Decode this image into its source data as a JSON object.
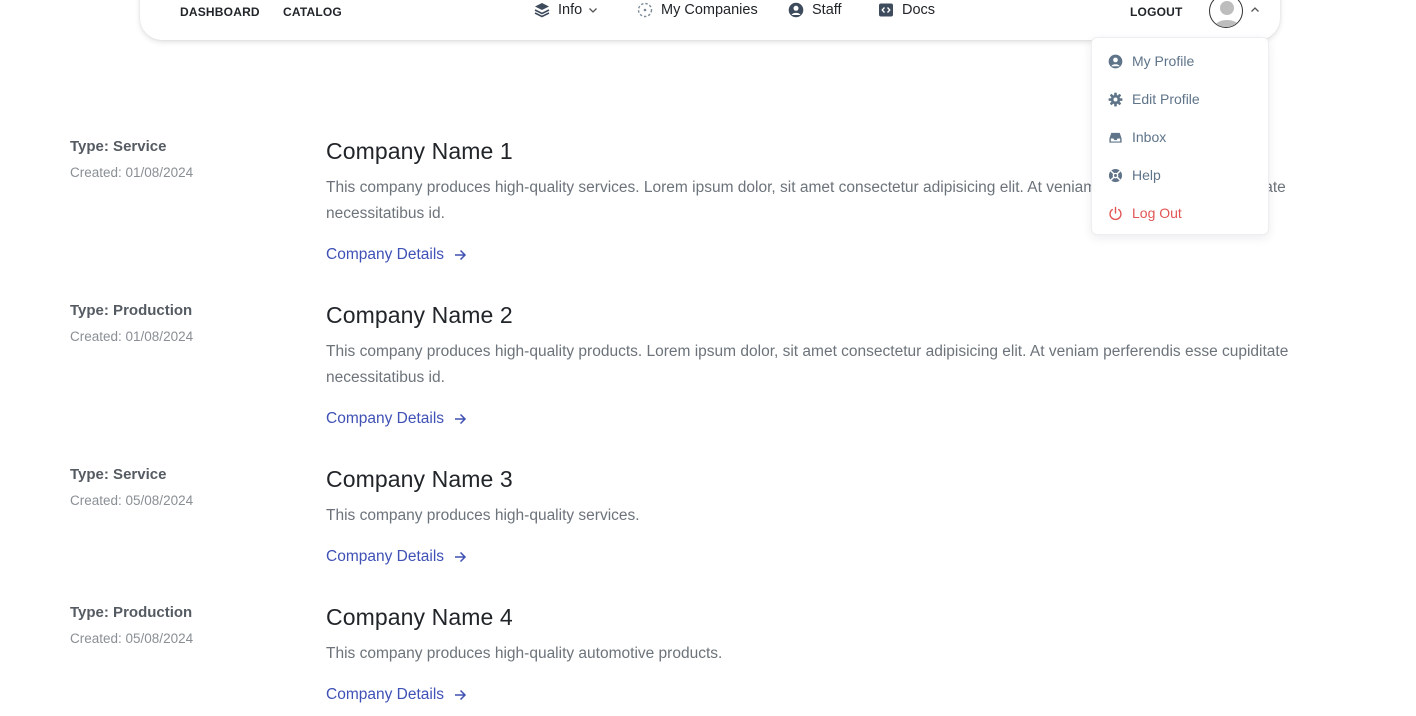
{
  "navbar": {
    "dashboard": "DASHBOARD",
    "catalog": "CATALOG",
    "info": "Info",
    "my_companies": "My Companies",
    "staff": "Staff",
    "docs": "Docs",
    "logout": "LOGOUT"
  },
  "profile_menu": {
    "items": [
      {
        "label": "My Profile",
        "icon": "user-circle-icon"
      },
      {
        "label": "Edit Profile",
        "icon": "gear-icon"
      },
      {
        "label": "Inbox",
        "icon": "inbox-icon"
      },
      {
        "label": "Help",
        "icon": "lifebuoy-icon"
      },
      {
        "label": "Log Out",
        "icon": "power-icon"
      }
    ]
  },
  "companies": [
    {
      "type": "Type: Service",
      "created": "Created: 01/08/2024",
      "name": "Company Name 1",
      "description": "This company produces high-quality services. Lorem ipsum dolor, sit amet consectetur adipisicing elit. At veniam perferendis esse cupiditate necessitatibus id.",
      "link": "Company Details"
    },
    {
      "type": "Type: Production",
      "created": "Created: 01/08/2024",
      "name": "Company Name 2",
      "description": "This company produces high-quality products. Lorem ipsum dolor, sit amet consectetur adipisicing elit. At veniam perferendis esse cupiditate necessitatibus id.",
      "link": "Company Details"
    },
    {
      "type": "Type: Service",
      "created": "Created: 05/08/2024",
      "name": "Company Name 3",
      "description": "This company produces high-quality services.",
      "link": "Company Details"
    },
    {
      "type": "Type: Production",
      "created": "Created: 05/08/2024",
      "name": "Company Name 4",
      "description": "This company produces high-quality automotive products.",
      "link": "Company Details"
    }
  ],
  "colors": {
    "link": "#3f51b5",
    "danger": "#e25555",
    "menu_text": "#5f7489"
  }
}
